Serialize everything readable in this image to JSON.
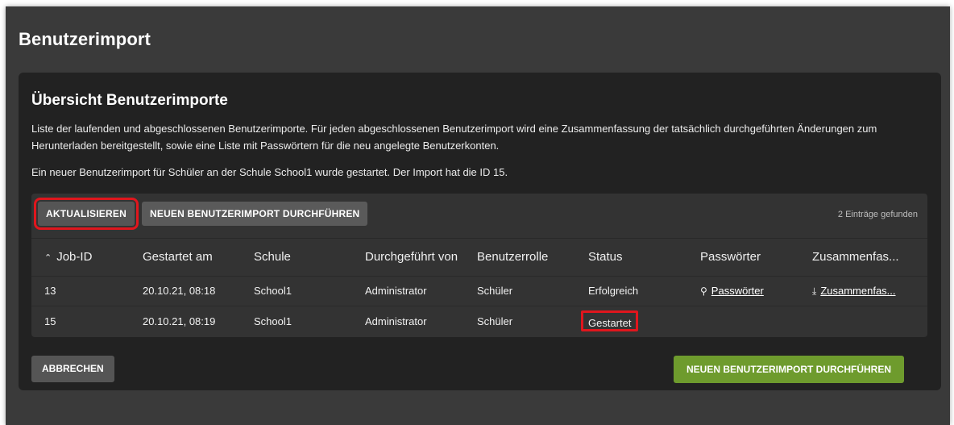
{
  "page": {
    "title": "Benutzerimport"
  },
  "card": {
    "title": "Übersicht Benutzerimporte",
    "description": "Liste der laufenden und abgeschlossenen Benutzerimporte. Für jeden abgeschlossenen Benutzerimport wird eine Zusammenfassung der tatsächlich durchgeführten Änderungen zum Herunterladen bereitgestellt, sowie eine Liste mit Passwörtern für die neu angelegte Benutzerkonten.",
    "notice": "Ein neuer Benutzerimport für Schüler an der Schule School1 wurde gestartet. Der Import hat die ID 15."
  },
  "toolbar": {
    "refresh_label": "AKTUALISIEREN",
    "new_import_label": "NEUEN BENUTZERIMPORT DURCHFÜHREN",
    "count_label": "2 Einträge gefunden"
  },
  "table": {
    "sort_icon": "chevron-up-icon",
    "headers": {
      "job_id": "Job-ID",
      "started": "Gestartet am",
      "school": "Schule",
      "performed_by": "Durchgeführt von",
      "role": "Benutzerrolle",
      "status": "Status",
      "passwords": "Passwörter",
      "summary": "Zusammenfas..."
    },
    "rows": [
      {
        "job_id": "13",
        "started": "20.10.21, 08:18",
        "school": "School1",
        "performed_by": "Administrator",
        "role": "Schüler",
        "status": "Erfolgreich",
        "passwords_link": "Passwörter",
        "passwords_icon": "key-icon",
        "summary_link": "Zusammenfas...",
        "summary_icon": "download-icon"
      },
      {
        "job_id": "15",
        "started": "20.10.21, 08:19",
        "school": "School1",
        "performed_by": "Administrator",
        "role": "Schüler",
        "status": "Gestartet"
      }
    ]
  },
  "footer": {
    "cancel_label": "ABBRECHEN",
    "new_import_label": "NEUEN BENUTZERIMPORT DURCHFÜHREN"
  },
  "colors": {
    "background": "#3a3a3a",
    "card": "#222222",
    "grid": "#333333",
    "primary": "#6e9b2d",
    "highlight": "#e0161d"
  }
}
